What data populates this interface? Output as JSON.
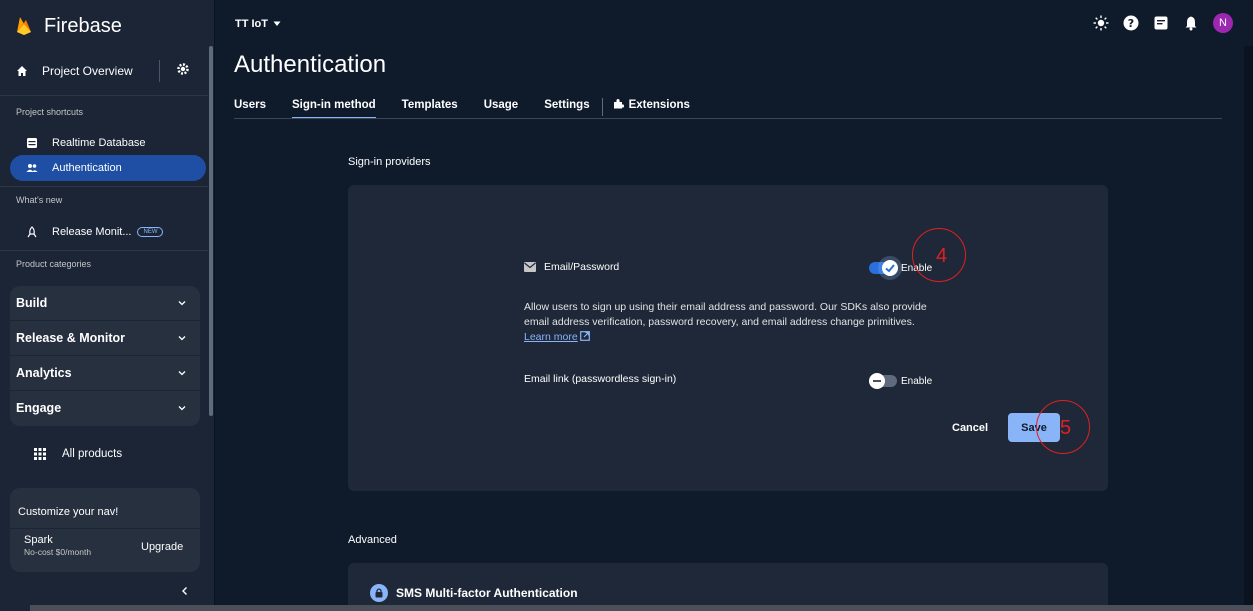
{
  "colors": {
    "accent": "#8ab4f8",
    "active_nav": "#1f4fa5",
    "annotation": "#e02020",
    "avatar": "#9c27b0"
  },
  "sidebar": {
    "brand": "Firebase",
    "overview": "Project Overview",
    "sections": {
      "shortcuts": "Project shortcuts",
      "whats_new": "What's new",
      "categories": "Product categories"
    },
    "shortcuts": [
      {
        "label": "Realtime Database",
        "icon": "database-icon"
      },
      {
        "label": "Authentication",
        "icon": "people-icon"
      }
    ],
    "release_item": {
      "label": "Release Monit...",
      "badge": "NEW",
      "icon": "rocket-icon"
    },
    "categories": [
      "Build",
      "Release & Monitor",
      "Analytics",
      "Engage"
    ],
    "all_products": "All products",
    "customize": "Customize your nav!",
    "plan": {
      "name": "Spark",
      "price": "No-cost $0/month",
      "upgrade": "Upgrade"
    }
  },
  "topbar": {
    "project": "TT IoT",
    "avatar_letter": "N"
  },
  "main": {
    "title": "Authentication",
    "tabs": [
      "Users",
      "Sign-in method",
      "Templates",
      "Usage",
      "Settings",
      "Extensions"
    ],
    "active_tab": "Sign-in method",
    "providers_heading": "Sign-in providers",
    "email_password": {
      "label": "Email/Password",
      "enable_label": "Enable",
      "enabled": true,
      "description": "Allow users to sign up using their email address and password. Our SDKs also provide email address verification, password recovery, and email address change primitives.",
      "learn_more": "Learn more"
    },
    "email_link": {
      "label": "Email link (passwordless sign-in)",
      "enable_label": "Enable",
      "enabled": false
    },
    "cancel": "Cancel",
    "save": "Save",
    "advanced_heading": "Advanced",
    "mfa": "SMS Multi-factor Authentication"
  },
  "annotations": {
    "step4": "4",
    "step5": "5"
  }
}
